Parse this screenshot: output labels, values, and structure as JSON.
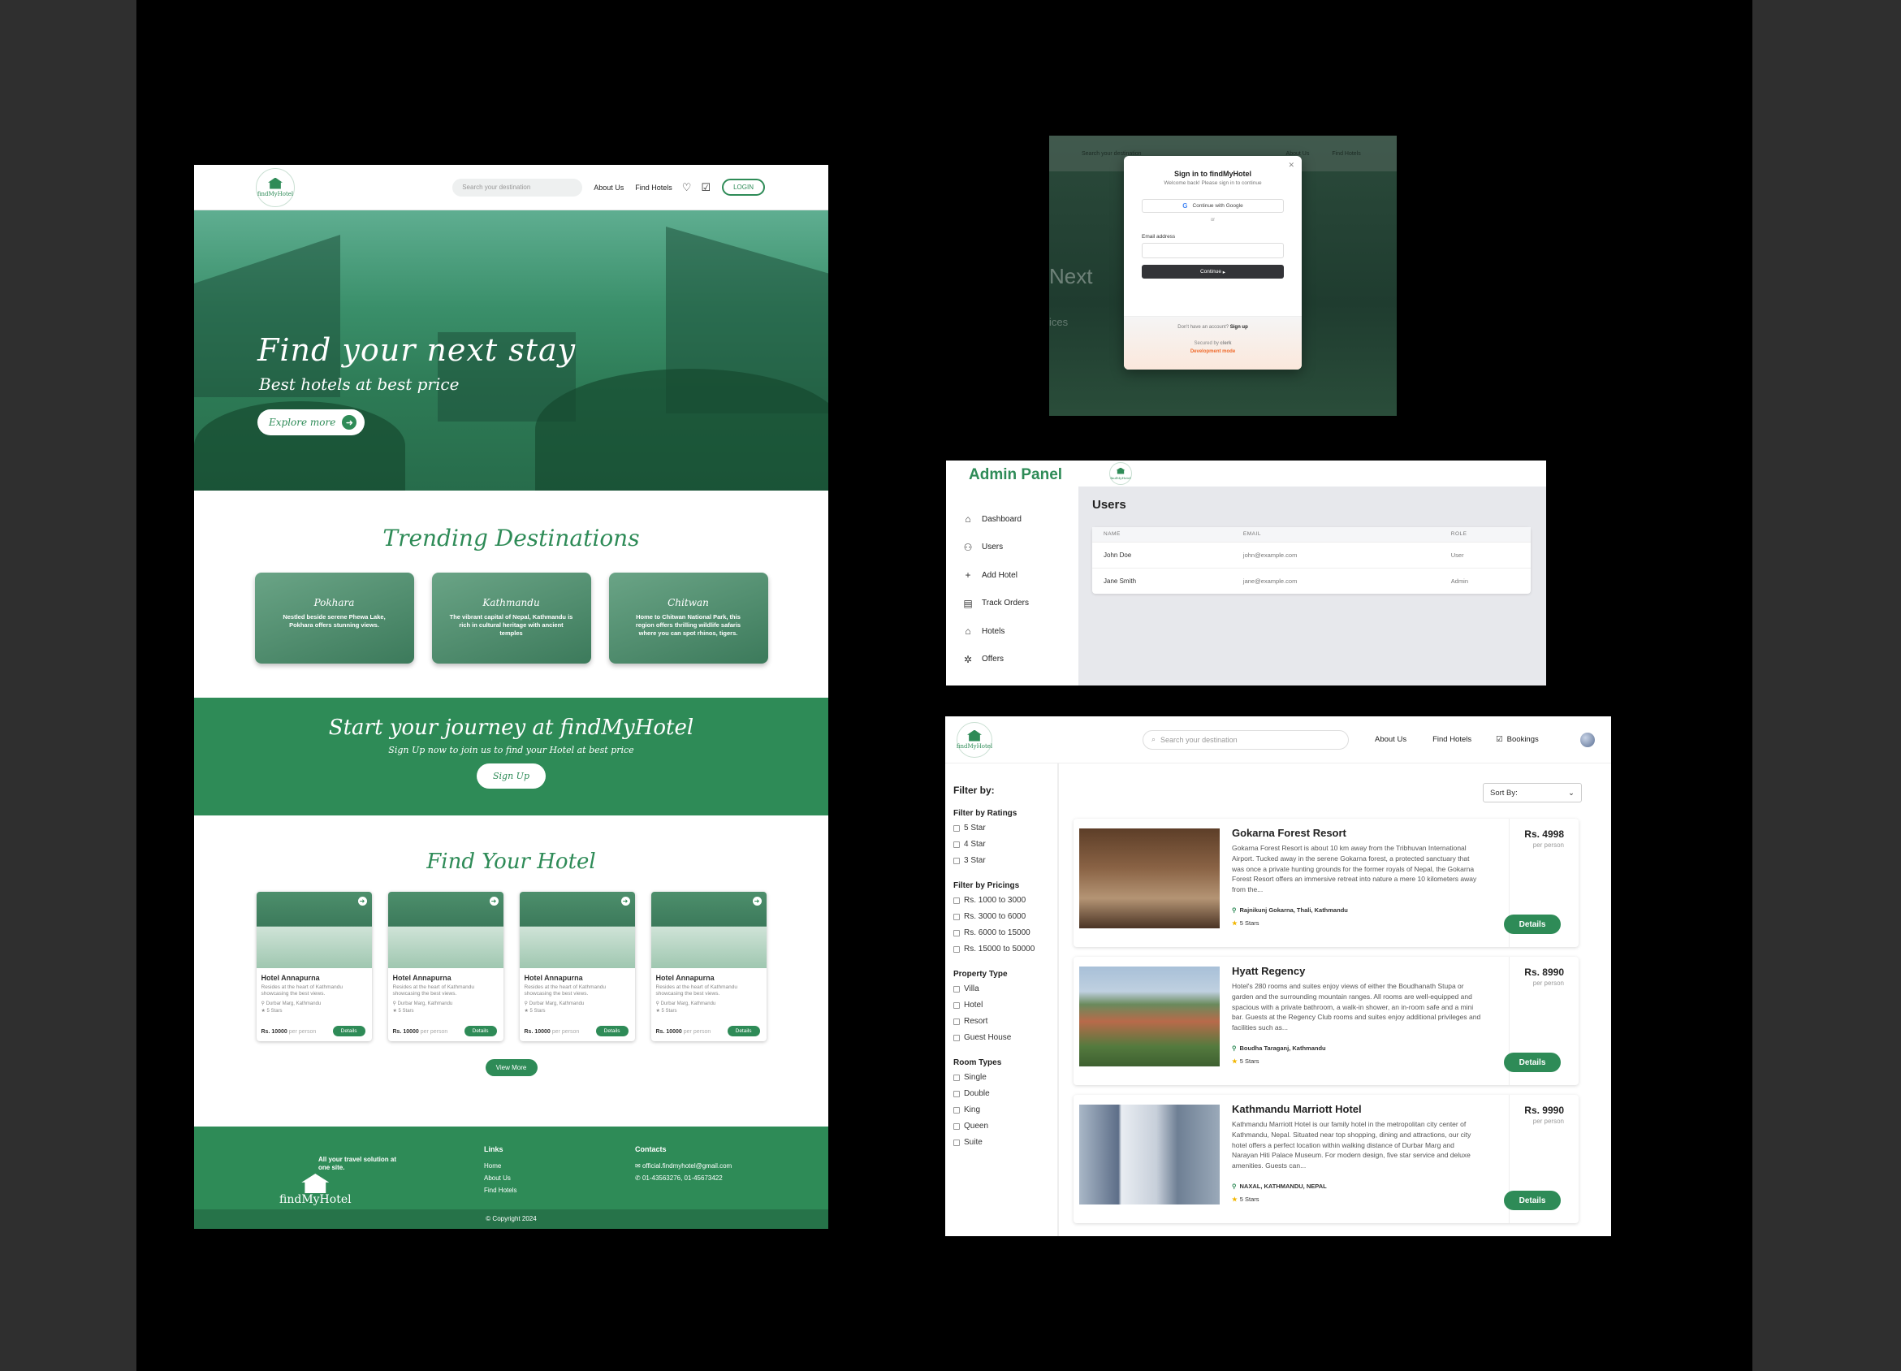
{
  "landing": {
    "nav": {
      "logo_text": "findMyHotel",
      "search_placeholder": "Search your destination",
      "about": "About Us",
      "find_hotels": "Find Hotels",
      "login": "LOGIN",
      "favorites_icon": "heart-icon",
      "bookings_icon": "clipboard-check-icon"
    },
    "hero": {
      "title": "Find your next stay",
      "subtitle": "Best hotels at best price",
      "cta": "Explore more"
    },
    "trending": {
      "title": "Trending Destinations",
      "items": [
        {
          "name": "Pokhara",
          "desc": "Nestled beside serene Phewa Lake, Pokhara offers stunning views."
        },
        {
          "name": "Kathmandu",
          "desc": "The vibrant capital of Nepal, Kathmandu is rich in cultural heritage with ancient temples"
        },
        {
          "name": "Chitwan",
          "desc": "Home to Chitwan National Park, this region offers thrilling wildlife safaris where you can spot rhinos, tigers."
        }
      ]
    },
    "journey": {
      "title": "Start your journey at findMyHotel",
      "subtitle": "Sign Up now to join us to find your Hotel at best price",
      "cta": "Sign Up"
    },
    "find_hotel": {
      "title": "Find Your Hotel",
      "cards": [
        {
          "name": "Hotel Annapurna",
          "desc": "Resides at the heart of Kathmandu showcasing the best views.",
          "location": "Durbar Marg, Kathmandu",
          "stars": "5 Stars",
          "price": "Rs. 10000",
          "per": "per person",
          "cta": "Details"
        },
        {
          "name": "Hotel Annapurna",
          "desc": "Resides at the heart of Kathmandu showcasing the best views.",
          "location": "Durbar Marg, Kathmandu",
          "stars": "5 Stars",
          "price": "Rs. 10000",
          "per": "per person",
          "cta": "Details"
        },
        {
          "name": "Hotel Annapurna",
          "desc": "Resides at the heart of Kathmandu showcasing the best views.",
          "location": "Durbar Marg, Kathmandu",
          "stars": "5 Stars",
          "price": "Rs. 10000",
          "per": "per person",
          "cta": "Details"
        },
        {
          "name": "Hotel Annapurna",
          "desc": "Resides at the heart of Kathmandu showcasing the best views.",
          "location": "Durbar Marg, Kathmandu",
          "stars": "5 Stars",
          "price": "Rs. 10000",
          "per": "per person",
          "cta": "Details"
        }
      ],
      "view_more": "View More"
    },
    "footer": {
      "tagline": "All your travel solution at one site.",
      "logo_text": "findMyHotel",
      "links_title": "Links",
      "links": [
        "Home",
        "About Us",
        "Find Hotels"
      ],
      "contacts_title": "Contacts",
      "email": "official.findmyhotel@gmail.com",
      "phone": "01-43563276, 01-45673422",
      "copyright": "Copyright 2024"
    }
  },
  "signin": {
    "bg_search": "Search your destination",
    "bg_about": "About Us",
    "bg_find": "Find Hotels",
    "bg_hero": "Next",
    "bg_sub": "ices",
    "title": "Sign in to findMyHotel",
    "subtitle": "Welcome back! Please sign in to continue",
    "google": "Continue with Google",
    "or": "or",
    "email_label": "Email address",
    "continue": "Continue",
    "no_account": "Don't have an account?",
    "signup": "Sign up",
    "secured": "Secured by",
    "clerk": "clerk",
    "dev_mode": "Development mode"
  },
  "admin": {
    "title": "Admin Panel",
    "menu": [
      {
        "label": "Dashboard",
        "icon": "home-icon"
      },
      {
        "label": "Users",
        "icon": "users-icon"
      },
      {
        "label": "Add Hotel",
        "icon": "plus-icon"
      },
      {
        "label": "Track Orders",
        "icon": "clipboard-icon"
      },
      {
        "label": "Hotels",
        "icon": "building-icon"
      },
      {
        "label": "Offers",
        "icon": "offers-icon"
      }
    ],
    "logo_text": "findMyHotel",
    "section_title": "Users",
    "columns": [
      "NAME",
      "EMAIL",
      "ROLE"
    ],
    "rows": [
      [
        "John Doe",
        "john@example.com",
        "User"
      ],
      [
        "Jane Smith",
        "jane@example.com",
        "Admin"
      ]
    ]
  },
  "listing": {
    "nav": {
      "logo_text": "findMyHotel",
      "search_placeholder": "Search your destination",
      "about": "About Us",
      "find_hotels": "Find Hotels",
      "bookings": "Bookings"
    },
    "filter_title": "Filter by:",
    "filter_groups": [
      {
        "title": "Filter by Ratings",
        "options": [
          "5 Star",
          "4 Star",
          "3 Star"
        ]
      },
      {
        "title": "Filter by Pricings",
        "options": [
          "Rs. 1000 to 3000",
          "Rs. 3000 to 6000",
          "Rs. 6000 to 15000",
          "Rs. 15000 to 50000"
        ]
      },
      {
        "title": "Property Type",
        "options": [
          "Villa",
          "Hotel",
          "Resort",
          "Guest House"
        ]
      },
      {
        "title": "Room Types",
        "options": [
          "Single",
          "Double",
          "King",
          "Queen",
          "Suite"
        ]
      }
    ],
    "sort_label": "Sort By:",
    "hotels": [
      {
        "name": "Gokarna Forest Resort",
        "desc": "Gokarna Forest Resort is about 10 km away from the Tribhuvan International Airport. Tucked away in the serene Gokarna forest, a protected sanctuary that was once a private hunting grounds for the former royals of Nepal, the Gokarna Forest Resort offers an immersive retreat into nature a mere 10 kilometers away from the...",
        "location": "Rajnikunj Gokarna, Thali, Kathmandu",
        "stars": "5 Stars",
        "price": "Rs. 4998",
        "per": "per person",
        "cta": "Details"
      },
      {
        "name": "Hyatt Regency",
        "desc": "Hotel's 280 rooms and suites enjoy views of either the Boudhanath Stupa or garden and the surrounding mountain ranges. All rooms are well-equipped and spacious with a private bathroom, a walk-in shower, an in-room safe and a mini bar. Guests at the Regency Club rooms and suites enjoy additional privileges and facilities such as...",
        "location": "Boudha Taraganj, Kathmandu",
        "stars": "5 Stars",
        "price": "Rs. 8990",
        "per": "per person",
        "cta": "Details"
      },
      {
        "name": "Kathmandu Marriott Hotel",
        "desc": "Kathmandu Marriott Hotel is our family hotel in the metropolitan city center of Kathmandu, Nepal. Situated near top shopping, dining and attractions, our city hotel offers a perfect location within walking distance of Durbar Marg and Narayan Hiti Palace Museum. For modern design, five star service and deluxe amenities. Guests can...",
        "location": "NAXAL, KATHMANDU, NEPAL",
        "stars": "5 Stars",
        "price": "Rs. 9990",
        "per": "per person",
        "cta": "Details"
      }
    ]
  },
  "colors": {
    "brand_green": "#2e8b57",
    "canvas": "#000000",
    "frame": "#2f2f2f"
  }
}
